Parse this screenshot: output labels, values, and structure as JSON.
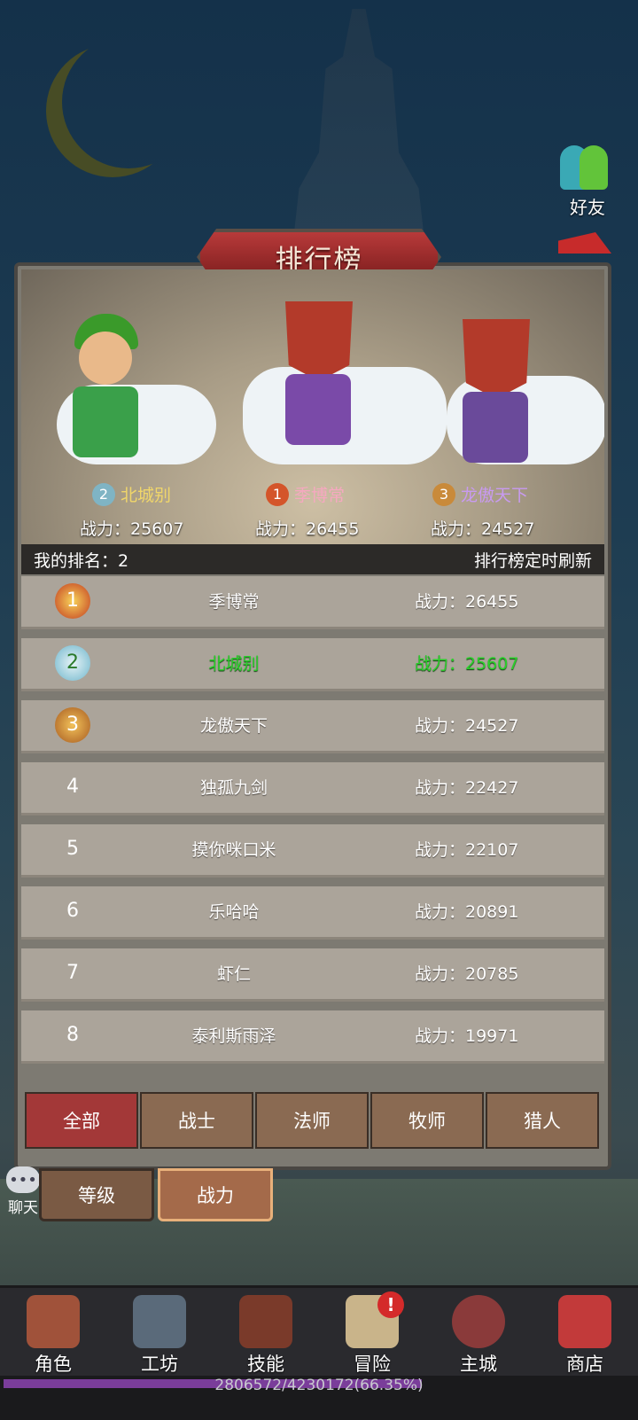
{
  "header": {
    "friends_label": "好友"
  },
  "title": "排行榜",
  "podium": [
    {
      "place": "2",
      "name": "北城别",
      "power": "战力：25607"
    },
    {
      "place": "1",
      "name": "季博常",
      "power": "战力：26455"
    },
    {
      "place": "3",
      "name": "龙傲天下",
      "power": "战力：24527"
    }
  ],
  "my_rank": {
    "label": "我的排名：2",
    "refresh_note": "排行榜定时刷新"
  },
  "rows": [
    {
      "rank": "1",
      "name": "季博常",
      "power": "战力：26455"
    },
    {
      "rank": "2",
      "name": "北城别",
      "power": "战力：25607"
    },
    {
      "rank": "3",
      "name": "龙傲天下",
      "power": "战力：24527"
    },
    {
      "rank": "4",
      "name": "独孤九剑",
      "power": "战力：22427"
    },
    {
      "rank": "5",
      "name": "摸你咪口米",
      "power": "战力：22107"
    },
    {
      "rank": "6",
      "name": "乐哈哈",
      "power": "战力：20891"
    },
    {
      "rank": "7",
      "name": "虾仁",
      "power": "战力：20785"
    },
    {
      "rank": "8",
      "name": "泰利斯雨泽",
      "power": "战力：19971"
    }
  ],
  "class_tabs": [
    "全部",
    "战士",
    "法师",
    "牧师",
    "猎人"
  ],
  "sort_tabs": [
    "等级",
    "战力"
  ],
  "chat_label": "聊天",
  "nav": [
    "角色",
    "工坊",
    "技能",
    "冒险",
    "主城",
    "商店"
  ],
  "nav_notification": "!",
  "xp": {
    "text": "2806572/4230172(66.35%)",
    "progress": 0.6635
  },
  "colors": {
    "accent_red": "#a33838",
    "self_highlight": "#2bd12b",
    "gold_text": "#f0d66a"
  }
}
